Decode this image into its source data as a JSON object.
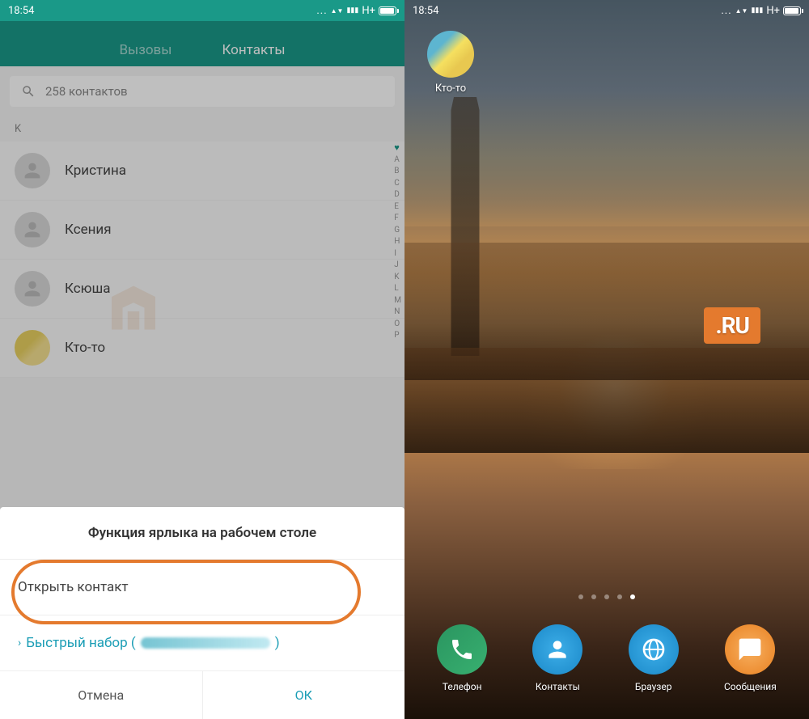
{
  "status": {
    "time": "18:54",
    "network": "H+"
  },
  "left": {
    "tabs": {
      "calls": "Вызовы",
      "contacts": "Контакты"
    },
    "search_placeholder": "258 контактов",
    "section": "K",
    "contacts": [
      {
        "name": "Кристина"
      },
      {
        "name": "Ксения"
      },
      {
        "name": "Ксюша"
      },
      {
        "name": "Кто-то"
      }
    ],
    "alpha": [
      "♥",
      "A",
      "B",
      "C",
      "D",
      "E",
      "F",
      "G",
      "H",
      "I",
      "J",
      "K",
      "L",
      "M",
      "N",
      "O",
      "P"
    ],
    "dialog": {
      "title": "Функция ярлыка на рабочем столе",
      "option_open": "Открыть контакт",
      "option_quick": "Быстрый набор (",
      "option_quick_close": ")",
      "cancel": "Отмена",
      "ok": "ОК"
    }
  },
  "right": {
    "shortcut_label": "Кто-то",
    "dock": [
      {
        "label": "Телефон"
      },
      {
        "label": "Контакты"
      },
      {
        "label": "Браузер"
      },
      {
        "label": "Сообщения"
      }
    ]
  },
  "watermark": {
    "right_text": ".RU"
  }
}
